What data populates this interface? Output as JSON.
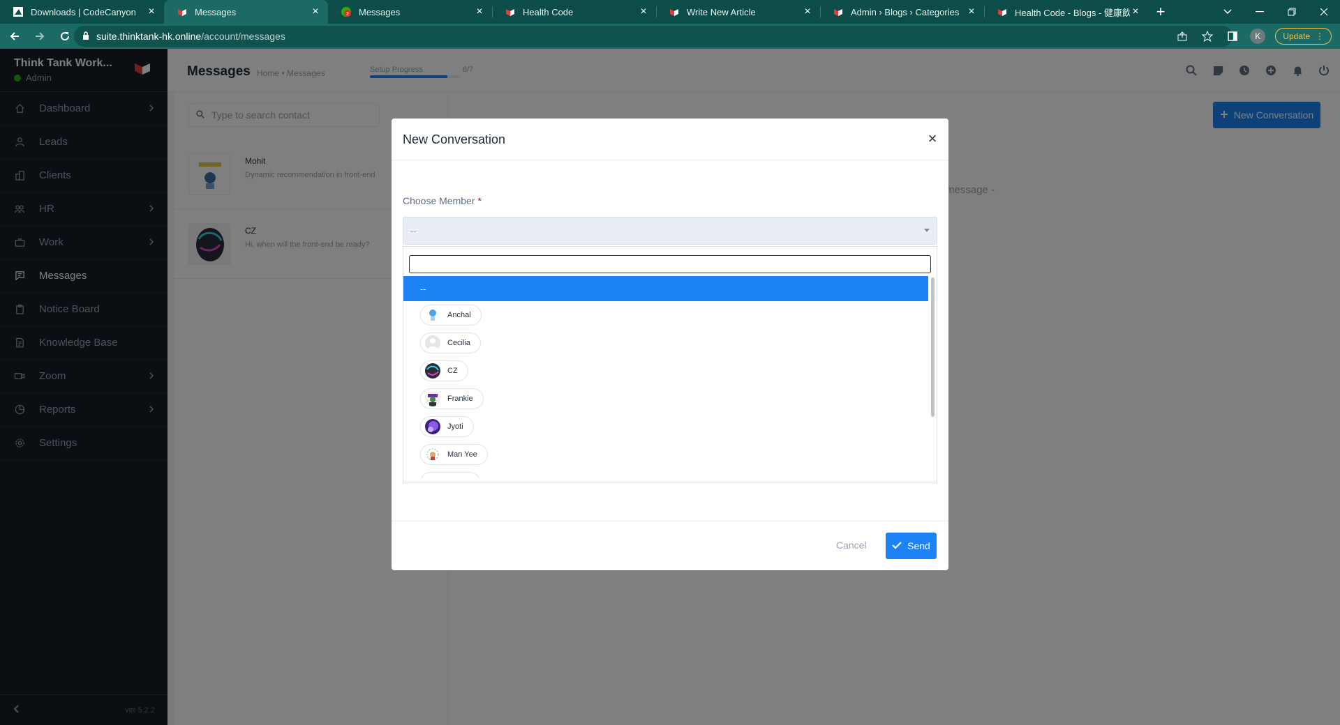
{
  "browser": {
    "tabs": [
      {
        "title": "Downloads | CodeCanyon",
        "favicon": "codecanyon-icon"
      },
      {
        "title": "Messages",
        "favicon": "worksuite-icon",
        "active": true
      },
      {
        "title": "Messages",
        "favicon": "chat-badge-icon",
        "badge": "2"
      },
      {
        "title": "Health Code",
        "favicon": "worksuite-icon"
      },
      {
        "title": "Write New Article",
        "favicon": "worksuite-icon"
      },
      {
        "title": "Admin › Blogs › Categories",
        "favicon": "worksuite-icon"
      },
      {
        "title": "Health Code - Blogs - 健康飲食",
        "favicon": "worksuite-icon"
      }
    ],
    "url_host": "suite.thinktank-hk.online",
    "url_path": "/account/messages",
    "profile_initial": "K",
    "update_label": "Update"
  },
  "sidebar": {
    "brand_name": "Think Tank Work...",
    "role": "Admin",
    "items": [
      {
        "label": "Dashboard",
        "icon": "house-icon",
        "has_arrow": true
      },
      {
        "label": "Leads",
        "icon": "person-icon",
        "has_arrow": false
      },
      {
        "label": "Clients",
        "icon": "building-icon",
        "has_arrow": false
      },
      {
        "label": "HR",
        "icon": "people-icon",
        "has_arrow": true
      },
      {
        "label": "Work",
        "icon": "briefcase-icon",
        "has_arrow": true
      },
      {
        "label": "Messages",
        "icon": "chat-icon",
        "has_arrow": false,
        "active": true
      },
      {
        "label": "Notice Board",
        "icon": "clipboard-icon",
        "has_arrow": false
      },
      {
        "label": "Knowledge Base",
        "icon": "document-icon",
        "has_arrow": false
      },
      {
        "label": "Zoom",
        "icon": "camera-icon",
        "has_arrow": true
      },
      {
        "label": "Reports",
        "icon": "pie-chart-icon",
        "has_arrow": true
      },
      {
        "label": "Settings",
        "icon": "gear-icon",
        "has_arrow": false
      }
    ],
    "version": "ver 5.2.2"
  },
  "header": {
    "title": "Messages",
    "breadcrumb": "Home • Messages",
    "setup_label": "Setup Progress",
    "setup_count": "6/7",
    "setup_progress": 0.857
  },
  "contacts": {
    "search_placeholder": "Type to search contact",
    "items": [
      {
        "name": "Mohit",
        "message": "Dynamic recommendation in front-end"
      },
      {
        "name": "CZ",
        "message": "Hi, when will the front-end be ready?"
      }
    ]
  },
  "chat": {
    "hint": "message -",
    "new_conversation_label": "New Conversation"
  },
  "modal": {
    "title": "New Conversation",
    "field_label": "Choose Member",
    "required_mark": "*",
    "select_value": "--",
    "selected_option": "--",
    "members": [
      "Anchal",
      "Cecilia",
      "CZ",
      "Frankie",
      "Jyoti",
      "Man Yee"
    ],
    "cancel_label": "Cancel",
    "send_label": "Send"
  },
  "colors": {
    "primary": "#1d82f5",
    "sidebar_bg": "#171f29",
    "browser_frame": "#0d4d49",
    "online": "#2cb100",
    "required": "#d30000"
  }
}
